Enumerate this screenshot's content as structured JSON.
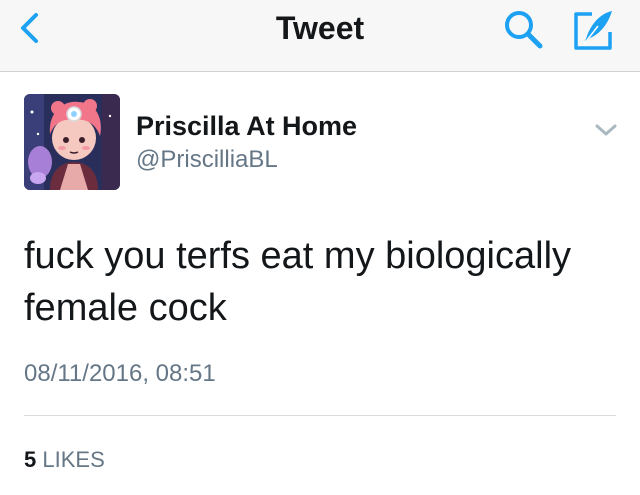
{
  "header": {
    "title": "Tweet",
    "back_icon": "back-chevron-icon",
    "search_icon": "search-icon",
    "compose_icon": "compose-feather-icon",
    "accent_color": "#1da1f2"
  },
  "tweet": {
    "display_name": "Priscilla At Home",
    "handle": "@PriscilliaBL",
    "text": "fuck you terfs eat my biologically female cock",
    "timestamp": "08/11/2016, 08:51",
    "likes_count": "5",
    "likes_label": "LIKES"
  }
}
